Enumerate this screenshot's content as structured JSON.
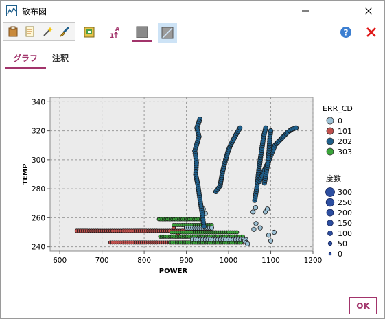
{
  "window": {
    "title": "散布図"
  },
  "tabs": [
    {
      "label": "グラフ",
      "active": true
    },
    {
      "label": "注釈",
      "active": false
    }
  ],
  "buttons": {
    "ok": "OK"
  },
  "icons": {
    "app": "scatterplot-icon",
    "minimize": "minimize-icon",
    "maximize": "maximize-icon",
    "close": "close-icon",
    "toolbar": [
      "clipboard-icon",
      "edit-document-icon",
      "wand-icon",
      "brush-icon",
      "export-icon",
      "sort-az-icon",
      "gray-square-icon",
      "no-fill-icon"
    ],
    "help": "help-icon",
    "exit": "red-x-icon"
  },
  "colors": {
    "accent": "#a2346b",
    "c0": "#9cc0d4",
    "c101": "#c0504d",
    "c202": "#1f5f8b",
    "c303": "#3aa43a"
  },
  "chart_data": {
    "type": "scatter",
    "xlabel": "POWER",
    "ylabel": "TEMP",
    "xlim": [
      577,
      1200
    ],
    "ylim": [
      237,
      343
    ],
    "xticks": [
      600,
      700,
      800,
      900,
      1000,
      1100,
      1200
    ],
    "yticks": [
      240,
      260,
      280,
      300,
      320,
      340
    ],
    "grid": true,
    "color_legend": {
      "title": "ERR_CD",
      "entries": [
        {
          "label": "0"
        },
        {
          "label": "101"
        },
        {
          "label": "202"
        },
        {
          "label": "303"
        }
      ]
    },
    "size_legend": {
      "title": "度数",
      "entries": [
        {
          "label": "300",
          "value": 300
        },
        {
          "label": "250",
          "value": 250
        },
        {
          "label": "200",
          "value": 200
        },
        {
          "label": "150",
          "value": 150
        },
        {
          "label": "100",
          "value": 100
        },
        {
          "label": "50",
          "value": 50
        },
        {
          "label": "0",
          "value": 0
        }
      ]
    },
    "series": [
      {
        "name": "0",
        "color": "#9cc0d4",
        "rows": [
          {
            "x0": 900,
            "x1": 960,
            "step": 5,
            "y": 253
          },
          {
            "x0": 915,
            "x1": 1045,
            "step": 6,
            "y": 245
          }
        ],
        "points": [
          [
            940,
            266
          ],
          [
            945,
            263
          ],
          [
            1038,
            244
          ],
          [
            1042,
            243
          ],
          [
            1045,
            242
          ],
          [
            1060,
            252
          ],
          [
            1065,
            256
          ],
          [
            1075,
            253
          ],
          [
            1095,
            248
          ],
          [
            1100,
            244
          ],
          [
            1108,
            250
          ],
          [
            1087,
            264
          ],
          [
            1092,
            266
          ],
          [
            1058,
            264
          ],
          [
            1064,
            267
          ]
        ]
      },
      {
        "name": "101",
        "color": "#c0504d",
        "rows": [
          {
            "x0": 640,
            "x1": 955,
            "step": 5,
            "y": 251
          },
          {
            "x0": 720,
            "x1": 1035,
            "step": 5,
            "y": 243
          }
        ],
        "points": [
          [
            870,
            253
          ],
          [
            880,
            249
          ]
        ]
      },
      {
        "name": "202",
        "color": "#1f5f8b",
        "paths": [
          [
            [
              932,
              328
            ],
            [
              925,
              322
            ],
            [
              930,
              316
            ],
            [
              920,
              306
            ],
            [
              924,
              298
            ],
            [
              922,
              290
            ],
            [
              927,
              283
            ],
            [
              930,
              277
            ],
            [
              933,
              271
            ],
            [
              938,
              262
            ],
            [
              940,
              257
            ],
            [
              942,
              254
            ]
          ],
          [
            [
              970,
              278
            ],
            [
              980,
              282
            ],
            [
              986,
              292
            ],
            [
              993,
              300
            ],
            [
              1000,
              307
            ],
            [
              1008,
              312
            ],
            [
              1017,
              317
            ],
            [
              1027,
              322
            ]
          ],
          [
            [
              1062,
              272
            ],
            [
              1067,
              281
            ],
            [
              1071,
              291
            ],
            [
              1075,
              300
            ],
            [
              1079,
              308
            ],
            [
              1083,
              316
            ],
            [
              1088,
              322
            ]
          ],
          [
            [
              1073,
              285
            ],
            [
              1085,
              293
            ],
            [
              1095,
              299
            ],
            [
              1103,
              305
            ],
            [
              1110,
              310
            ],
            [
              1120,
              313
            ],
            [
              1130,
              316
            ],
            [
              1140,
              319
            ],
            [
              1150,
              321
            ],
            [
              1160,
              322
            ]
          ],
          [
            [
              1085,
              284
            ],
            [
              1092,
              296
            ],
            [
              1096,
              306
            ],
            [
              1098,
              316
            ],
            [
              1100,
              320
            ]
          ]
        ]
      },
      {
        "name": "303",
        "color": "#3aa43a",
        "rows": [
          {
            "x0": 838,
            "x1": 1035,
            "step": 4,
            "y": 247
          },
          {
            "x0": 862,
            "x1": 1030,
            "step": 4,
            "y": 243
          },
          {
            "x0": 865,
            "x1": 1020,
            "step": 5,
            "y": 250
          },
          {
            "x0": 835,
            "x1": 935,
            "step": 4,
            "y": 259
          },
          {
            "x0": 870,
            "x1": 960,
            "step": 5,
            "y": 255
          }
        ]
      }
    ]
  }
}
